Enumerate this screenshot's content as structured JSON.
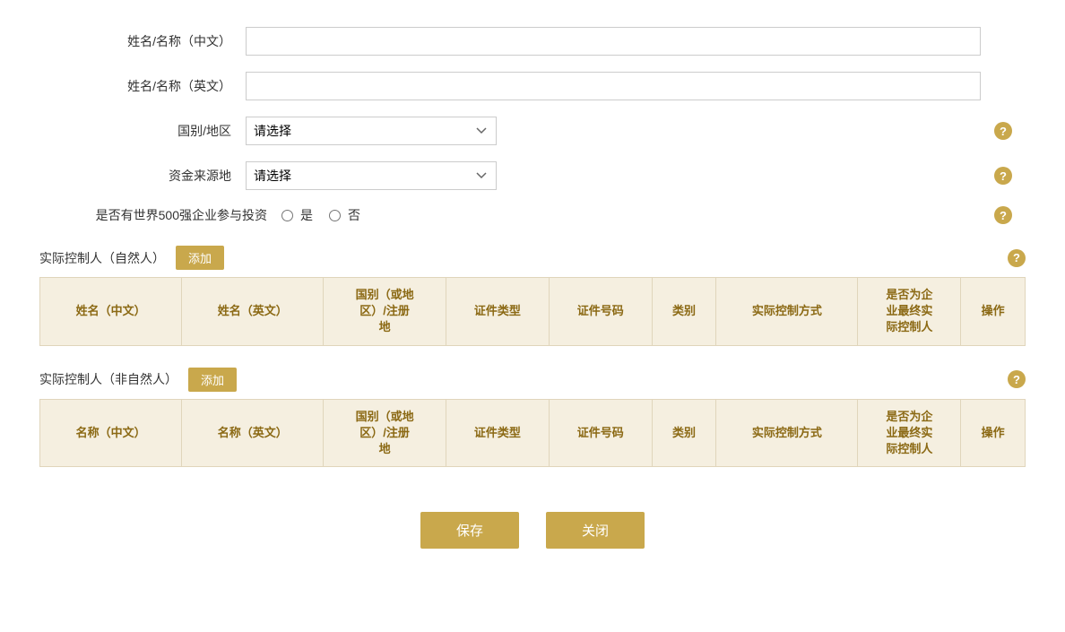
{
  "form": {
    "name_cn_label": "姓名/名称（中文）",
    "name_en_label": "姓名/名称（英文）",
    "country_label": "国别/地区",
    "country_placeholder": "请选择",
    "fund_source_label": "资金来源地",
    "fund_source_placeholder": "请选择",
    "fortune500_label": "是否有世界500强企业参与投资",
    "yes_label": "是",
    "no_label": "否"
  },
  "section1": {
    "title": "实际控制人（自然人）",
    "add_label": "添加",
    "columns": [
      "姓名（中文）",
      "姓名（英文）",
      "国别（或地\n区）/注册\n地",
      "证件类型",
      "证件号码",
      "类别",
      "实际控制方式",
      "是否为企\n业最终实\n际控制人",
      "操作"
    ]
  },
  "section2": {
    "title": "实际控制人（非自然人）",
    "add_label": "添加",
    "columns": [
      "名称（中文）",
      "名称（英文）",
      "国别（或地\n区）/注册\n地",
      "证件类型",
      "证件号码",
      "类别",
      "实际控制方式",
      "是否为企\n业最终实\n际控制人",
      "操作"
    ]
  },
  "buttons": {
    "save": "保存",
    "close": "关闭"
  }
}
